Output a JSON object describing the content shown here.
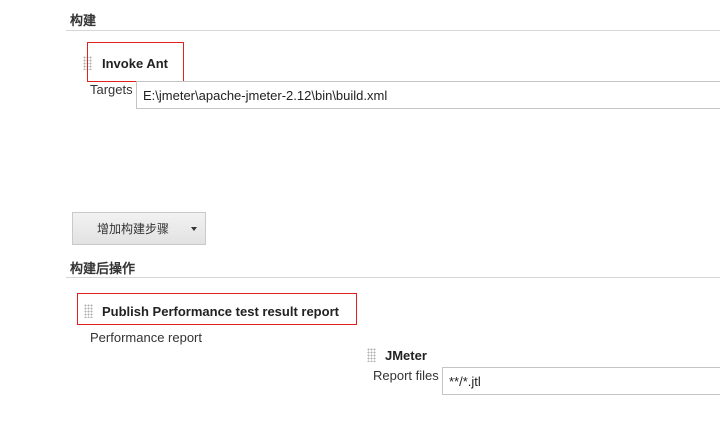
{
  "build_section": {
    "title": "构建",
    "step": {
      "title": "Invoke Ant",
      "targets_label": "Targets",
      "targets_value": "E:\\jmeter\\apache-jmeter-2.12\\bin\\build.xml"
    },
    "add_step_label": "增加构建步骤"
  },
  "post_build_section": {
    "title": "构建后操作",
    "step": {
      "title": "Publish Performance test result report",
      "report_label": "Performance report",
      "parser": {
        "title": "JMeter",
        "report_files_label": "Report files",
        "report_files_value": "**/*.jtl"
      }
    }
  },
  "colors": {
    "highlight": "#e0211d",
    "divider": "#d6d6d6"
  },
  "icons": {
    "drag": "drag-handle-icon",
    "dropdown": "chevron-down-icon"
  }
}
